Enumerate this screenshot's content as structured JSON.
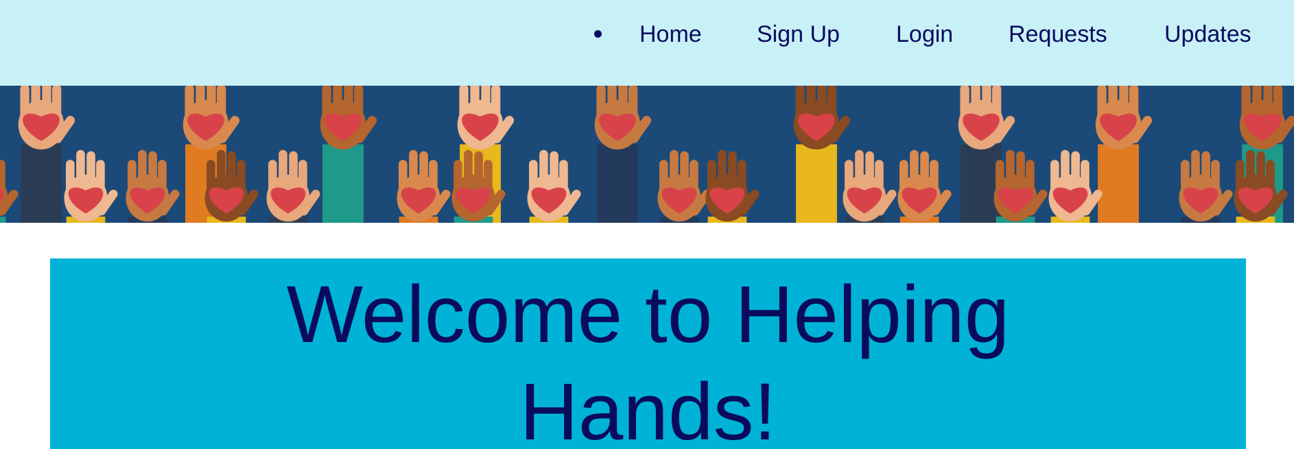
{
  "nav": {
    "items": [
      {
        "label": "Home"
      },
      {
        "label": "Sign Up"
      },
      {
        "label": "Login"
      },
      {
        "label": "Requests"
      },
      {
        "label": "Updates"
      }
    ]
  },
  "banner": {
    "image": "raised hands holding red hearts illustration"
  },
  "hero": {
    "title_line1": "Welcome to Helping",
    "title_line2": "Hands!"
  },
  "colors": {
    "nav_background": "#c8f0f7",
    "nav_text": "#0b0b5e",
    "banner_background": "#1c4a78",
    "hero_background": "#00b3d6",
    "hero_text": "#0b0b5e",
    "heart": "#d8434a"
  }
}
